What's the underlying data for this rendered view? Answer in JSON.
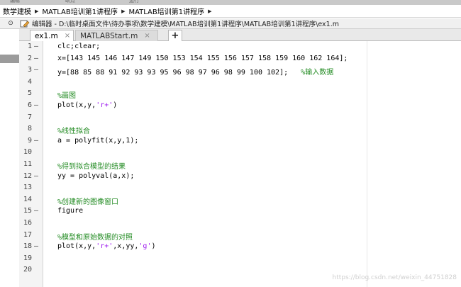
{
  "top_strip": {
    "labels": [
      "编辑",
      "断点",
      "运行"
    ]
  },
  "breadcrumb": {
    "items": [
      "数学建模",
      "MATLAB培训第1讲程序",
      "MATLAB培训第1讲程序"
    ]
  },
  "editor_bar": {
    "title": "编辑器 - D:\\临时桌面文件\\待办事项\\数学建模\\MATLAB培训第1讲程序\\MATLAB培训第1讲程序\\ex1.m"
  },
  "tabs": [
    {
      "label": "ex1.m",
      "close": "×",
      "active": true
    },
    {
      "label": "MATLABStart.m",
      "close": "×",
      "active": false
    }
  ],
  "tab_add": "+",
  "editor": {
    "lines": [
      {
        "num": "1",
        "dash": "—",
        "code": "clc;clear;",
        "kind": "code"
      },
      {
        "num": "2",
        "dash": "—",
        "code": "x=[143 145 146 147 149 150 153 154 155 156 157 158 159 160 162 164];",
        "kind": "code"
      },
      {
        "num": "3",
        "dash": "—",
        "code": "y=[88 85 88 91 92 93 93 95 96 98 97 96 98 99 100 102];",
        "comment": "%输入数据",
        "kind": "code_comment"
      },
      {
        "num": "4",
        "dash": "",
        "code": "",
        "kind": "blank"
      },
      {
        "num": "5",
        "dash": "",
        "code": "%画图",
        "kind": "comment"
      },
      {
        "num": "6",
        "dash": "—",
        "code_pre": "plot(x,y,",
        "str": "'r+'",
        "code_post": ")",
        "kind": "code_str"
      },
      {
        "num": "7",
        "dash": "",
        "code": "",
        "kind": "blank"
      },
      {
        "num": "8",
        "dash": "",
        "code": "%线性拟合",
        "kind": "comment"
      },
      {
        "num": "9",
        "dash": "—",
        "code": "a = polyfit(x,y,1);",
        "kind": "code"
      },
      {
        "num": "10",
        "dash": "",
        "code": "",
        "kind": "blank"
      },
      {
        "num": "11",
        "dash": "",
        "code": "%得到拟合模型的结果",
        "kind": "comment"
      },
      {
        "num": "12",
        "dash": "—",
        "code": "yy = polyval(a,x);",
        "kind": "code"
      },
      {
        "num": "13",
        "dash": "",
        "code": "",
        "kind": "blank"
      },
      {
        "num": "14",
        "dash": "",
        "code": "%创建新的图像窗口",
        "kind": "comment"
      },
      {
        "num": "15",
        "dash": "—",
        "code": "figure",
        "kind": "code"
      },
      {
        "num": "16",
        "dash": "",
        "code": "",
        "kind": "blank"
      },
      {
        "num": "17",
        "dash": "",
        "code": "%模型和原始数据的对照",
        "kind": "comment"
      },
      {
        "num": "18",
        "dash": "—",
        "code_pre": "plot(x,y,",
        "str": "'r+'",
        "code_mid": ",x,yy,",
        "str2": "'g'",
        "code_post": ")",
        "kind": "code_str2"
      },
      {
        "num": "19",
        "dash": "",
        "code": "",
        "kind": "blank"
      },
      {
        "num": "20",
        "dash": "",
        "code": "",
        "kind": "blank"
      }
    ]
  },
  "watermark": "https://blog.csdn.net/weixin_44751828",
  "colors": {
    "comment": "#228b22",
    "string": "#a020f0",
    "gutter": "#f4f4f4",
    "tab_active": "#ffffff"
  }
}
